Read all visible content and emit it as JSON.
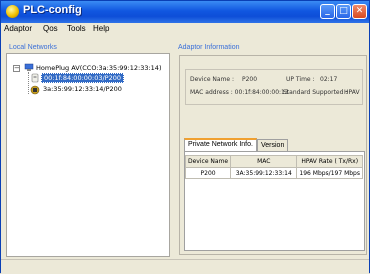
{
  "window": {
    "title": "PLC-config"
  },
  "menu": [
    "Adaptor",
    "Qos",
    "Tools",
    "Help"
  ],
  "left_panel": {
    "header": "Local Networks",
    "root": "HomePlug AV(CCO:3a:35:99:12:33:14)",
    "child_selected": "00:1f:84:00:00:03/P200",
    "child_2": "3a:35:99:12:33:14/P200"
  },
  "right_panel": {
    "header": "Adaptor Information",
    "device_name_label": "Device Name :",
    "device_name_value": "P200",
    "up_time_label": "UP Time :",
    "up_time_value": "02:17",
    "mac_label": "MAC address : 00:1f:84:00:00:13",
    "standard_label": "Standard Supported :",
    "standard_value": "HPAV",
    "tabs": [
      "Private Network Info.",
      "Version"
    ],
    "table": {
      "headers": [
        "Device Name",
        "MAC",
        "HPAV Rate ( Tx/Rx)"
      ],
      "rows": [
        [
          "P200",
          "3A:35:99:12:33:14",
          "196 Mbps/197 Mbps"
        ]
      ]
    }
  }
}
